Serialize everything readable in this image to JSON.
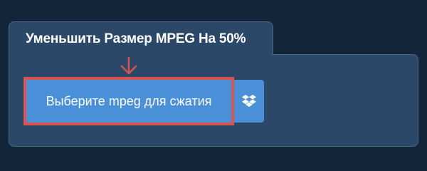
{
  "panel": {
    "title": "Уменьшить Размер MPEG На 50%"
  },
  "upload": {
    "choose_label": "Выберите mpeg для сжатия",
    "dropbox_icon": "dropbox-icon",
    "hint_icon": "arrow-down-icon"
  },
  "colors": {
    "background": "#132639",
    "panel": "#2c4868",
    "button": "#4a90d9",
    "highlight": "#d9534f"
  }
}
